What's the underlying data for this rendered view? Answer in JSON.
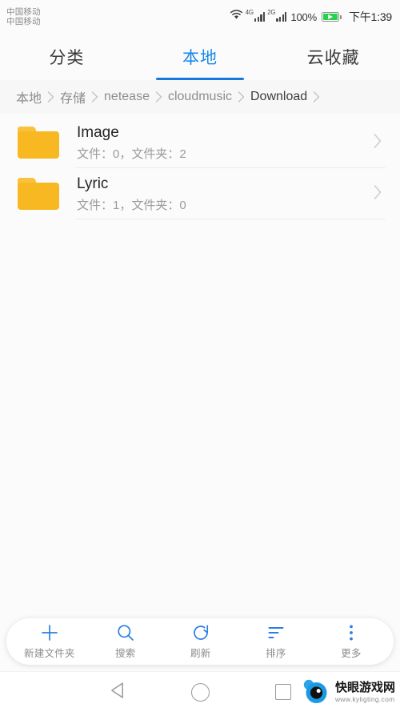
{
  "status_bar": {
    "carrier_line1": "中国移动",
    "carrier_line2": "中国移动",
    "wifi_icon": "wifi-icon",
    "sim1_network": "4G",
    "sim2_network": "2G",
    "battery_percent": "100%",
    "battery_icon": "battery-charging-icon",
    "clock": "下午1:39"
  },
  "tabs": [
    {
      "label": "分类",
      "active": false
    },
    {
      "label": "本地",
      "active": true
    },
    {
      "label": "云收藏",
      "active": false
    }
  ],
  "breadcrumb": {
    "separator_icon": "chevron-right-icon",
    "items": [
      {
        "label": "本地",
        "current": false
      },
      {
        "label": "存储",
        "current": false
      },
      {
        "label": "netease",
        "current": false
      },
      {
        "label": "cloudmusic",
        "current": false
      },
      {
        "label": "Download",
        "current": true
      }
    ]
  },
  "file_list": [
    {
      "name": "Image",
      "meta": "文件：0，文件夹：2",
      "icon": "folder-icon",
      "chevron": "chevron-right-icon"
    },
    {
      "name": "Lyric",
      "meta": "文件：1，文件夹：0",
      "icon": "folder-icon",
      "chevron": "chevron-right-icon"
    }
  ],
  "toolbar": [
    {
      "label": "新建文件夹",
      "icon": "plus-icon"
    },
    {
      "label": "搜索",
      "icon": "search-icon"
    },
    {
      "label": "刷新",
      "icon": "refresh-icon"
    },
    {
      "label": "排序",
      "icon": "sort-icon"
    },
    {
      "label": "更多",
      "icon": "more-vertical-icon"
    }
  ],
  "nav_bar": {
    "back_icon": "back-triangle-icon",
    "home_icon": "home-circle-icon",
    "recents_icon": "recents-square-icon"
  },
  "watermark": {
    "name": "快眼游戏网",
    "url": "www.kyligting.com",
    "logo_icon": "eye-logo-icon"
  },
  "colors": {
    "accent_blue": "#1a87e8",
    "tab_underline": "#1779e0",
    "folder_amber": "#f8b821",
    "battery_green": "#25d34a",
    "page_background": "#fbfbfb",
    "breadcrumb_background": "#f7f7f7",
    "primary_text": "#242424",
    "secondary_text": "#9b9b9b"
  }
}
